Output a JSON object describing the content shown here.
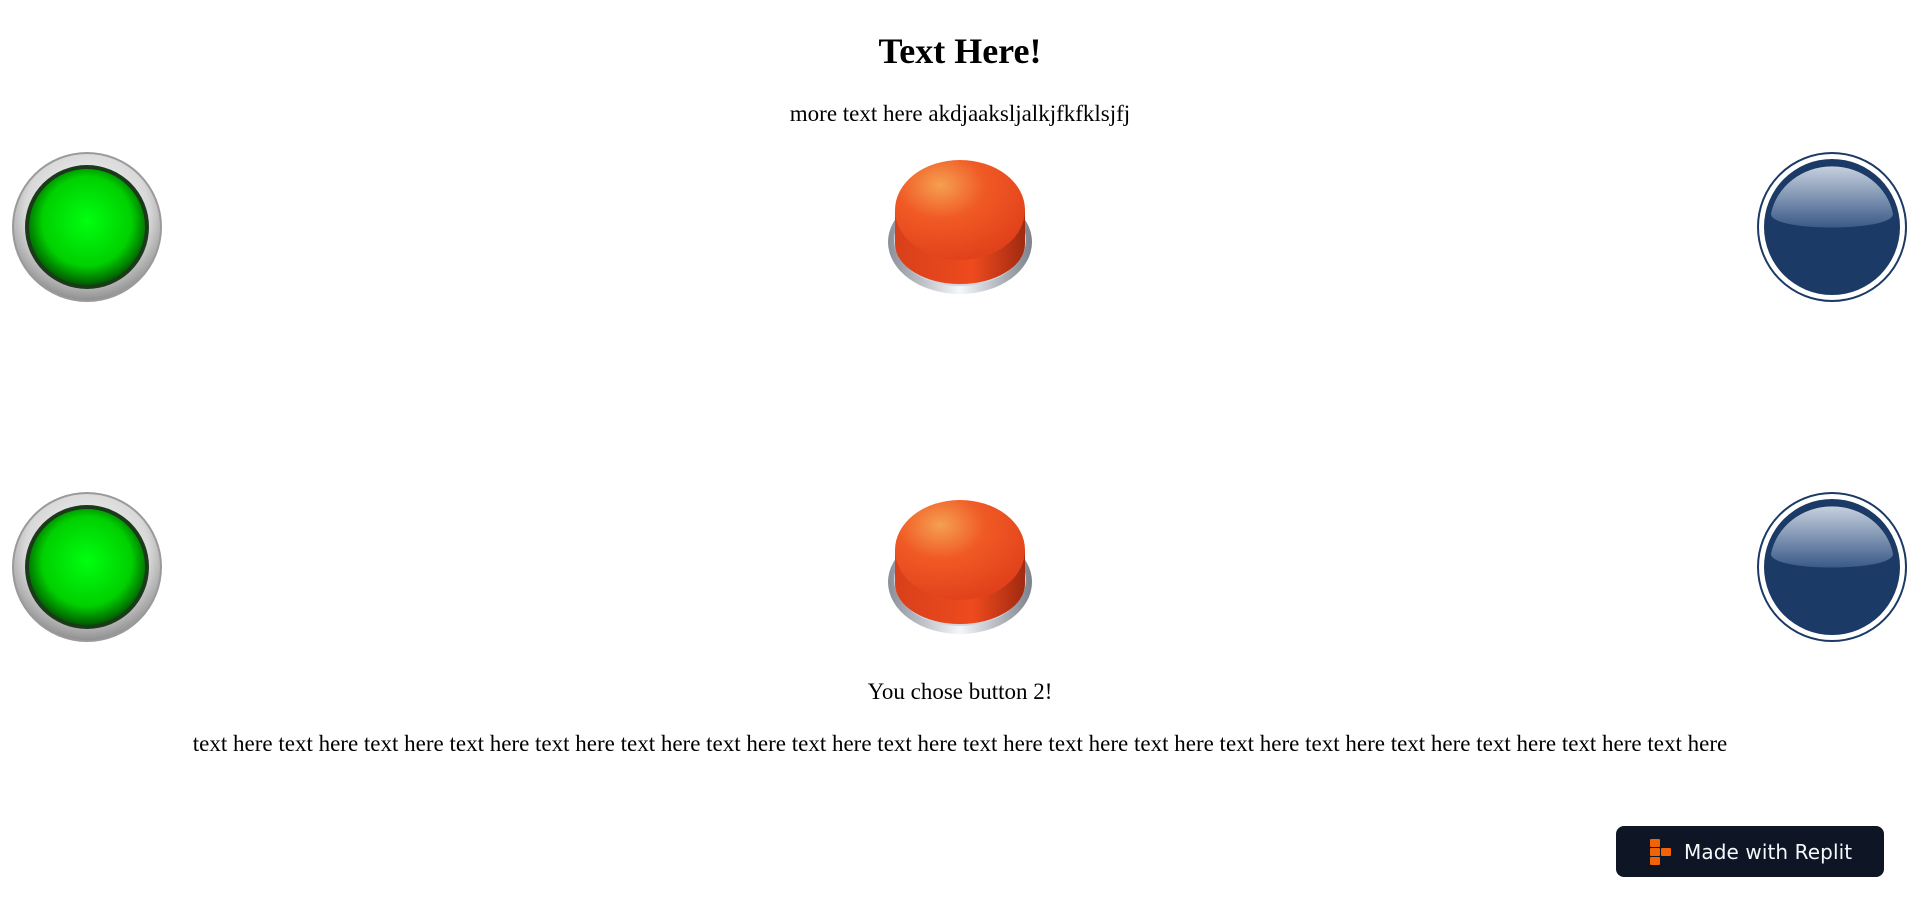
{
  "heading": "Text Here!",
  "subtitle": "more text here akdjaaksljalkjfkfklsjfj",
  "buttons": {
    "row1": [
      {
        "icon": "green-round-button",
        "color": "#00e000"
      },
      {
        "icon": "orange-push-button",
        "color": "#ee4a1e"
      },
      {
        "icon": "navy-glossy-button",
        "color": "#1c3a66"
      }
    ],
    "row2": [
      {
        "icon": "green-round-button",
        "color": "#00e000"
      },
      {
        "icon": "orange-push-button",
        "color": "#ee4a1e"
      },
      {
        "icon": "navy-glossy-button",
        "color": "#1c3a66"
      }
    ]
  },
  "choice_text": "You chose button 2!",
  "body_text": "text here text here text here text here text here text here text here text here text here text here text here text here text here text here text here text here text here text here",
  "badge": {
    "label": "Made with Replit",
    "icon": "replit-logo-icon",
    "background": "#0e1525",
    "accent": "#f26207"
  }
}
